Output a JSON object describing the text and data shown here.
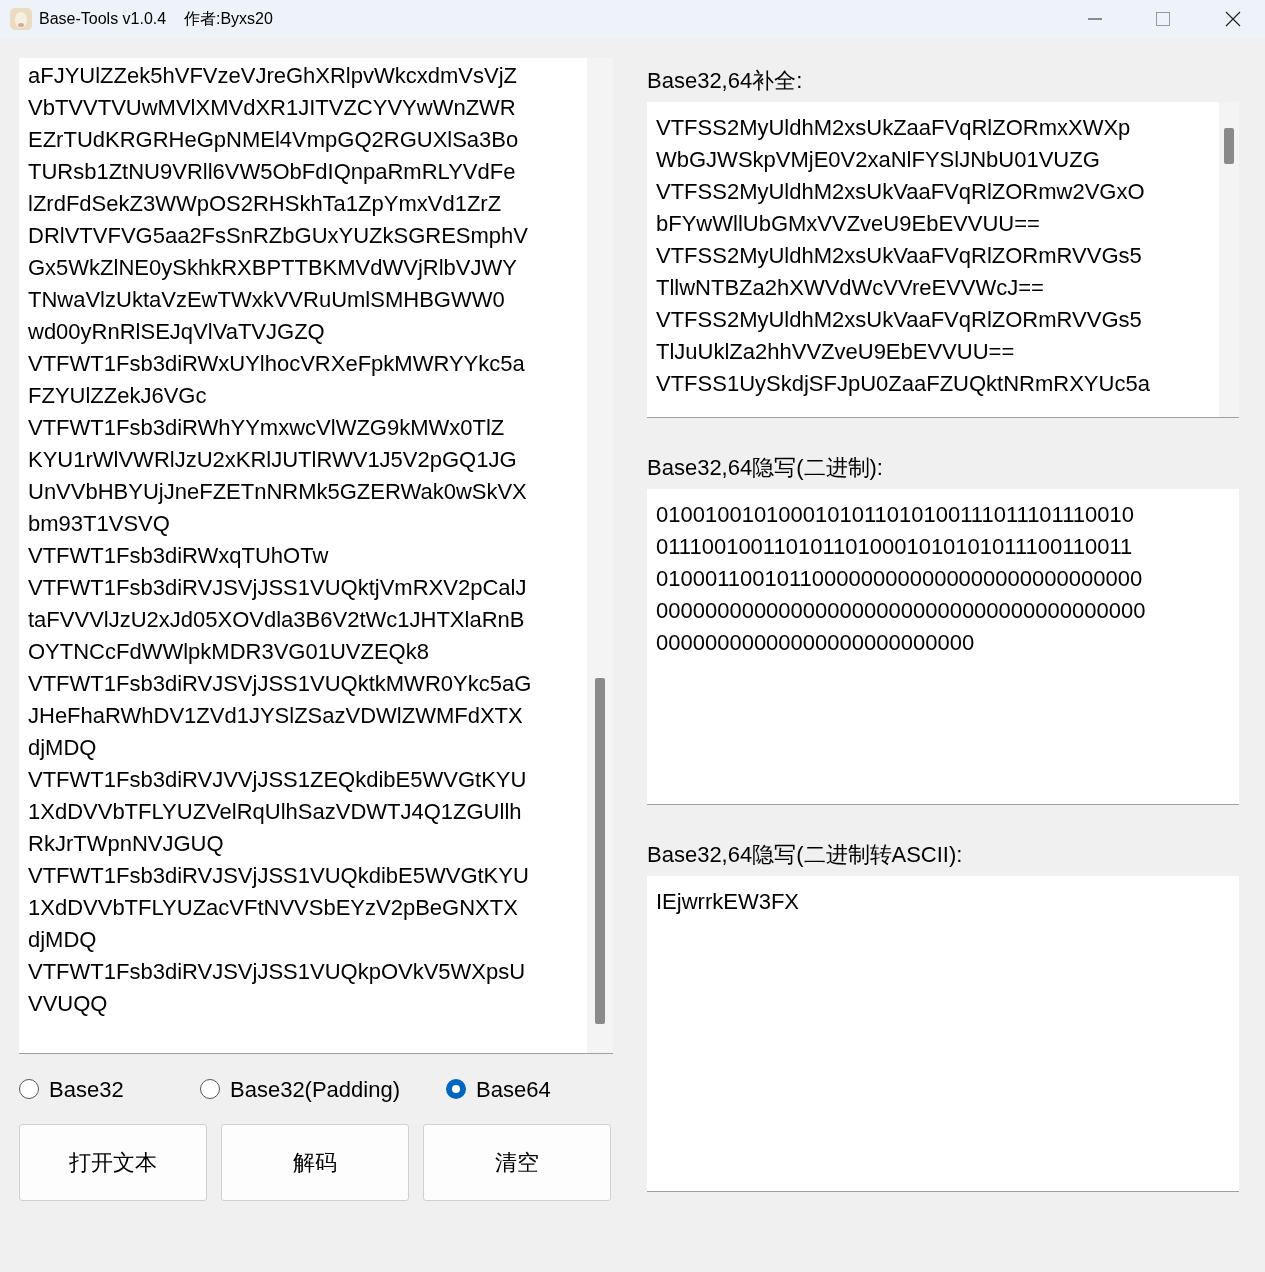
{
  "window": {
    "title": "Base-Tools v1.0.4    作者:Byxs20"
  },
  "input": {
    "lines": [
      "aFJYUlZZek5hVFVzeVJreGhXRlpvWkcxdmVsVjZ",
      "VbTVVTVUwMVlXMVdXR1JITVZCYVYwWnZWR",
      "EZrTUdKRGRHeGpNMEl4VmpGQ2RGUXlSa3Bo",
      "TURsb1ZtNU9VRll6VW5ObFdIQnpaRmRLYVdFe",
      "lZrdFdSekZ3WWpOS2RHSkhTa1ZpYmxVd1ZrZ",
      "DRlVTVFVG5aa2FsSnRZbGUxYUZkSGRESmphV",
      "Gx5WkZlNE0ySkhkRXBPTTBKMVdWVjRlbVJWY",
      "TNwaVlzUktaVzEwTWxkVVRuUmlSMHBGWW0",
      "wd00yRnRlSEJqVlVaTVJGZQ",
      "VTFWT1Fsb3diRWxUYlhocVRXeFpkMWRYYkc5a",
      "FZYUlZZekJ6VGc",
      "VTFWT1Fsb3diRWhYYmxwcVlWZG9kMWx0TlZ",
      "KYU1rWlVWRlJzU2xKRlJUTlRWV1J5V2pGQ1JG",
      "UnVVbHBYUjJneFZETnNRMk5GZERWak0wSkVX",
      "bm93T1VSVQ",
      "VTFWT1Fsb3diRWxqTUhOTw",
      "VTFWT1Fsb3diRVJSVjJSS1VUQktjVmRXV2pCalJ",
      "taFVVVlJzU2xJd05XOVdla3B6V2tWc1JHTXlaRnB",
      "OYTNCcFdWWlpkMDR3VG01UVZEQk8",
      "VTFWT1Fsb3diRVJSVjJSS1VUQktkMWR0Ykc5aG",
      "JHeFhaRWhDV1ZVd1JYSlZSazVDWlZWMFdXTX",
      "djMDQ",
      "VTFWT1Fsb3diRVJVVjJSS1ZEQkdibE5WVGtKYU",
      "1XdDVVbTFLYUZVelRqUlhSazVDWTJ4Q1ZGUllh",
      "RkJrTWpnNVJGUQ",
      "VTFWT1Fsb3diRVJSVjJSS1VUQkdibE5WVGtKYU",
      "1XdDVVbTFLYUZacVFtNVVSbEYzV2pBeGNXTX",
      "djMDQ",
      "VTFWT1Fsb3diRVJSVjJSS1VUQkpOVkV5WXpsU",
      "VVUQQ"
    ]
  },
  "modes": [
    {
      "label": "Base32",
      "selected": false
    },
    {
      "label": "Base32(Padding)",
      "selected": false
    },
    {
      "label": "Base64",
      "selected": true
    }
  ],
  "buttons": [
    "打开文本",
    "解码",
    "清空"
  ],
  "panels": [
    {
      "title": "Base32,64补全:",
      "lines": [
        "VTFSS2MyUldhM2xsUkZaaFVqRlZORmxXWXp",
        "WbGJWSkpVMjE0V2xaNlFYSlJNbU01VUZG",
        "VTFSS2MyUldhM2xsUkVaaFVqRlZORmw2VGxO",
        "bFYwWllUbGMxVVZveU9EbEVVUU==",
        "VTFSS2MyUldhM2xsUkVaaFVqRlZORmRVVGs5",
        "TllwNTBZa2hXWVdWcVVreEVVWcJ==",
        "VTFSS2MyUldhM2xsUkVaaFVqRlZORmRVVGs5",
        "TlJuUklZa2hhVVZveU9EbEVVUU==",
        "VTFSS1UySkdjSFJpU0ZaaFZUQktNRmRXYUc5a"
      ],
      "scrollable": true
    },
    {
      "title": "Base32,64隐写(二进制):",
      "lines": [
        "0100100101000101011010100111011101110010",
        "0111001001101011010001010101011100110011",
        "0100011001011000000000000000000000000000",
        "0000000000000000000000000000000000000000",
        "00000000000000000000000000"
      ],
      "scrollable": false
    },
    {
      "title": "Base32,64隐写(二进制转ASCII):",
      "lines": [
        "IEjwrrkEW3FX"
      ],
      "scrollable": false
    }
  ]
}
